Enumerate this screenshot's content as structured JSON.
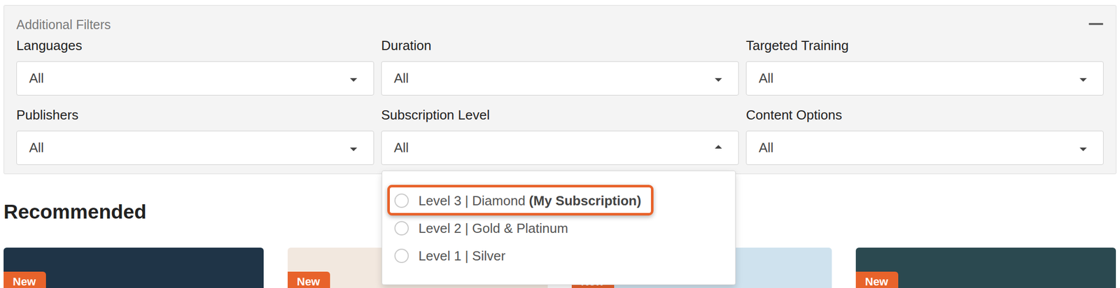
{
  "panel": {
    "title": "Additional Filters",
    "collapsed": false
  },
  "filters": [
    {
      "label": "Languages",
      "value": "All",
      "expanded": false
    },
    {
      "label": "Duration",
      "value": "All",
      "expanded": false
    },
    {
      "label": "Targeted Training",
      "value": "All",
      "expanded": false
    },
    {
      "label": "Publishers",
      "value": "All",
      "expanded": false
    },
    {
      "label": "Subscription Level",
      "value": "All",
      "expanded": true
    },
    {
      "label": "Content Options",
      "value": "All",
      "expanded": false
    }
  ],
  "subscription_options": [
    {
      "label": "Level 3 | Diamond",
      "note": "(My Subscription)",
      "selected": false,
      "highlighted": true
    },
    {
      "label": "Level 2 | Gold & Platinum",
      "selected": false,
      "highlighted": false
    },
    {
      "label": "Level 1 | Silver",
      "selected": false,
      "highlighted": false
    }
  ],
  "recommended": {
    "title": "Recommended",
    "cards": [
      {
        "badge": "New"
      },
      {
        "badge": "New"
      },
      {
        "badge": "New"
      },
      {
        "badge": "New"
      }
    ]
  }
}
